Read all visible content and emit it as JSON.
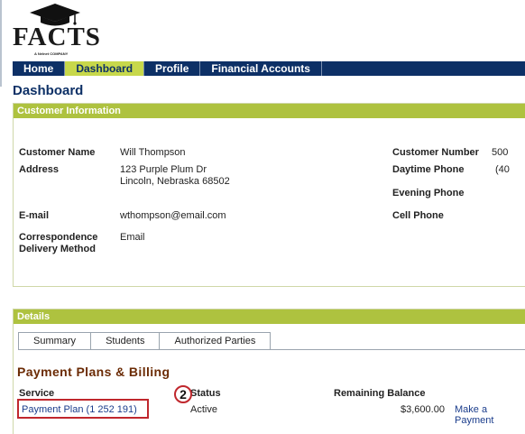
{
  "brand": {
    "name": "FACTS",
    "tagline": "A Nelnet COMPANY"
  },
  "nav": {
    "items": [
      {
        "label": "Home",
        "active": false
      },
      {
        "label": "Dashboard",
        "active": true
      },
      {
        "label": "Profile",
        "active": false
      },
      {
        "label": "Financial Accounts",
        "active": false
      }
    ]
  },
  "page": {
    "title": "Dashboard"
  },
  "customer": {
    "header": "Customer Information",
    "name_label": "Customer Name",
    "name_value": "Will Thompson",
    "address_label": "Address",
    "address_line1": "123 Purple Plum Dr",
    "address_line2": "Lincoln, Nebraska 68502",
    "email_label": "E-mail",
    "email_value": "wthompson@email.com",
    "correspondence_label_1": "Correspondence",
    "correspondence_label_2": "Delivery Method",
    "correspondence_value": "Email",
    "number_label": "Customer Number",
    "number_value": "500",
    "daytime_label": "Daytime Phone",
    "daytime_value": "(40",
    "evening_label": "Evening Phone",
    "cell_label": "Cell Phone"
  },
  "details": {
    "header": "Details",
    "tabs": [
      {
        "label": "Summary",
        "active": true
      },
      {
        "label": "Students",
        "active": false
      },
      {
        "label": "Authorized Parties",
        "active": false
      }
    ],
    "section_title": "Payment Plans & Billing",
    "columns": {
      "service": "Service",
      "status": "Status",
      "balance": "Remaining Balance"
    },
    "rows": [
      {
        "service": "Payment Plan (1 252 191)",
        "status": "Active",
        "balance": "$3,600.00",
        "action": "Make a Payment"
      }
    ],
    "callout_number": "2"
  },
  "colors": {
    "navy": "#0d3066",
    "green": "#aec23f",
    "highlight_red": "#c0272d",
    "section_brown": "#6b2b05"
  }
}
